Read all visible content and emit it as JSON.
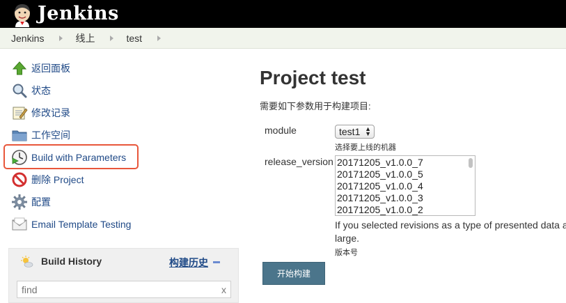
{
  "header": {
    "brand": "Jenkins",
    "logo_icon": "jenkins-butler-logo"
  },
  "breadcrumb": [
    "Jenkins",
    "线上",
    "test"
  ],
  "side": {
    "tasks": [
      {
        "label": "返回面板",
        "icon": "up-arrow-icon"
      },
      {
        "label": "状态",
        "icon": "magnifier-icon"
      },
      {
        "label": "修改记录",
        "icon": "notepad-icon"
      },
      {
        "label": "工作空间",
        "icon": "folder-icon"
      },
      {
        "label": "Build with Parameters",
        "icon": "clock-play-icon"
      },
      {
        "label": "删除 Project",
        "icon": "no-entry-icon"
      },
      {
        "label": "配置",
        "icon": "gear-icon"
      },
      {
        "label": "Email Template Testing",
        "icon": "envelope-icon"
      }
    ],
    "highlight_color": "#e8563a"
  },
  "build_history": {
    "title": "Build History",
    "link": "构建历史",
    "find_placeholder": "find",
    "clear": "x"
  },
  "main": {
    "title": "Project test",
    "description": "需要如下参数用于构建项目:",
    "params": {
      "module": {
        "label": "module",
        "selected": "test1",
        "hint": "选择要上线的机器"
      },
      "release_version": {
        "label": "release_version",
        "options": [
          "20171205_v1.0.0_7",
          "20171205_v1.0.0_5",
          "20171205_v1.0.0_4",
          "20171205_v1.0.0_3",
          "20171205_v1.0.0_2"
        ],
        "help_line1": "If you selected revisions as a type of presented data a",
        "help_line2": "large.",
        "hint": "版本号"
      }
    },
    "build_button": "开始构建",
    "button_color": "#4b758b"
  }
}
